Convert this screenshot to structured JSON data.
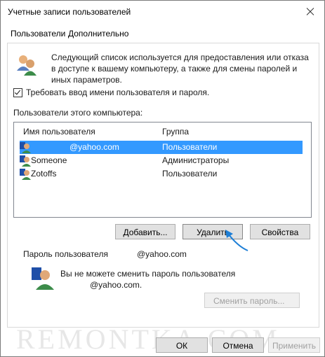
{
  "window": {
    "title": "Учетные записи пользователей"
  },
  "tabs": [
    {
      "label": "Пользователи"
    },
    {
      "label": "Дополнительно"
    }
  ],
  "info": {
    "text": "Следующий список используется для предоставления или отказа в доступе к вашему компьютеру, а также для смены паролей и иных параметров."
  },
  "require_login": {
    "label": "Требовать ввод имени пользователя и пароля.",
    "checked": true
  },
  "users_section": {
    "label": "Пользователи этого компьютера:"
  },
  "table": {
    "columns": [
      "Имя пользователя",
      "Группа"
    ],
    "rows": [
      {
        "name": "@yahoo.com",
        "group": "Пользователи"
      },
      {
        "name": "Someone",
        "group": "Администраторы"
      },
      {
        "name": "Zotoffs",
        "group": "Пользователи"
      }
    ]
  },
  "buttons": {
    "add": "Добавить...",
    "delete": "Удалить",
    "properties": "Свойства",
    "change_password": "Сменить пароль...",
    "ok": "ОК",
    "cancel": "Отмена",
    "apply": "Применить"
  },
  "password_section": {
    "label": "Пароль пользователя",
    "user": "@yahoo.com",
    "message_line1": "Вы не можете сменить пароль пользователя",
    "message_line2": "@yahoo.com."
  },
  "watermark": "REMONTKA.COM",
  "colors": {
    "selection": "#3399ff",
    "arrow": "#1e7fd6"
  }
}
